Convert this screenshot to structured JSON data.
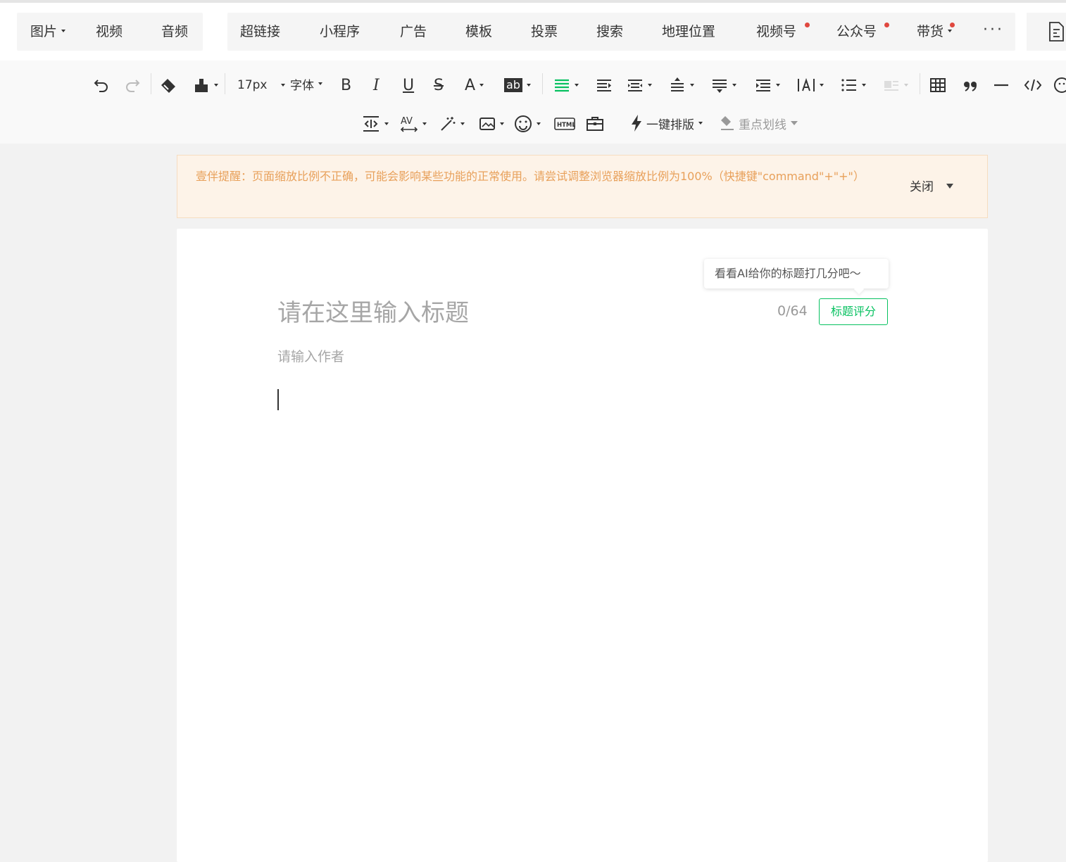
{
  "insert_bar": {
    "media": [
      {
        "label": "图片",
        "dropdown": true
      },
      {
        "label": "视频"
      },
      {
        "label": "音频"
      }
    ],
    "tools": [
      {
        "label": "超链接"
      },
      {
        "label": "小程序"
      },
      {
        "label": "广告"
      },
      {
        "label": "模板"
      },
      {
        "label": "投票"
      },
      {
        "label": "搜索"
      },
      {
        "label": "地理位置"
      },
      {
        "label": "视频号",
        "badge": true
      },
      {
        "label": "公众号",
        "badge": true
      },
      {
        "label": "带货",
        "badge": true,
        "dropdown": true
      }
    ],
    "more": "···"
  },
  "format_bar": {
    "font_size": "17px",
    "font_family": "字体",
    "bold": "B",
    "italic": "I",
    "underline": "U",
    "strike": "S",
    "font_color": "A",
    "bg_color": "ab",
    "auto_layout": "一键排版",
    "highlight_underline": "重点划线"
  },
  "notice": {
    "text": "壹伴提醒：页面缩放比例不正确，可能会影响某些功能的正常使用。请尝试调整浏览器缩放比例为100%（快捷键\"command\"+\"+\"）",
    "close": "关闭"
  },
  "editor": {
    "ai_tip": "看看AI给你的标题打几分吧～",
    "title_placeholder": "请在这里输入标题",
    "title_count": "0/64",
    "score_button": "标题评分",
    "author_placeholder": "请输入作者"
  },
  "colors": {
    "accent": "#07c160",
    "notice_text": "#e8a05a",
    "notice_bg": "#fdf3e8",
    "badge": "#e0483f"
  }
}
